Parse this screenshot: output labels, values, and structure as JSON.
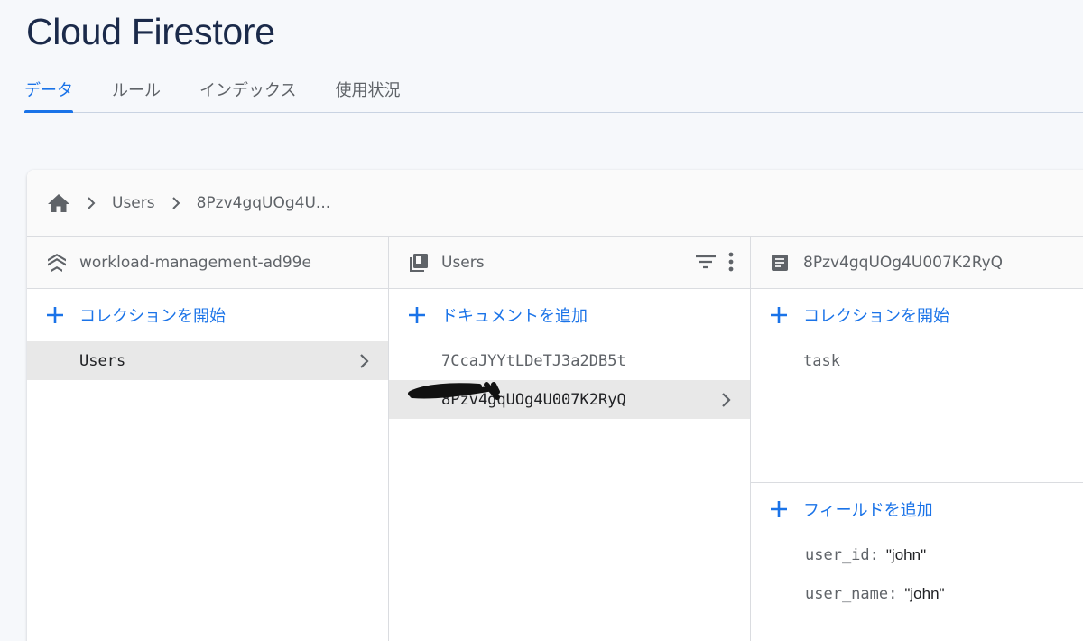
{
  "app": {
    "title": "Cloud Firestore"
  },
  "tabs": [
    {
      "label": "データ",
      "active": true
    },
    {
      "label": "ルール"
    },
    {
      "label": "インデックス"
    },
    {
      "label": "使用状況"
    }
  ],
  "breadcrumb": {
    "home_icon": "home-icon",
    "items": [
      "Users",
      "8Pzv4gqUOg4U..."
    ]
  },
  "columns": {
    "root": {
      "header": "workload-management-ad99e",
      "header_icon": "firestore-stack-icon",
      "add_label": "コレクションを開始",
      "items": [
        "Users"
      ]
    },
    "collection": {
      "header": "Users",
      "header_icon": "collection-icon",
      "add_label": "ドキュメントを追加",
      "items": [
        "7CcaJYYtLDeTJ3a2DB5t",
        "8Pzv4gqUOg4U007K2RyQ"
      ]
    },
    "document": {
      "header": "8Pzv4gqUOg4U007K2RyQ",
      "header_icon": "document-icon",
      "add_collection_label": "コレクションを開始",
      "subcollections": [
        "task"
      ],
      "add_field_label": "フィールドを追加",
      "fields": [
        {
          "key": "user_id:",
          "value": "\"john\""
        },
        {
          "key": "user_name:",
          "value": "\"john\""
        }
      ]
    }
  },
  "colors": {
    "accent": "#1a73e8",
    "title": "#1b2a4a",
    "selected_row": "#e8e8e8"
  }
}
